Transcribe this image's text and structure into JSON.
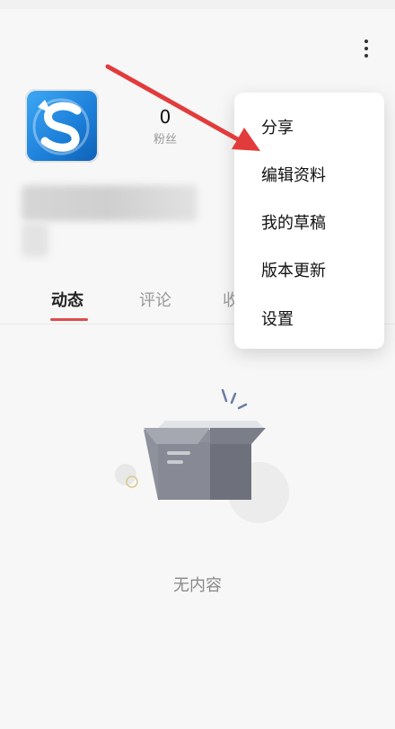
{
  "header": {
    "more_icon": "more-vertical-icon"
  },
  "profile": {
    "avatar_icon": "app-logo-s-icon",
    "fans_count": "0",
    "fans_label": "粉丝"
  },
  "tabs": {
    "items": [
      "动态",
      "评论",
      "收"
    ]
  },
  "empty": {
    "icon": "empty-box-icon",
    "text": "无内容"
  },
  "menu": {
    "items": [
      "分享",
      "编辑资料",
      "我的草稿",
      "版本更新",
      "设置"
    ]
  },
  "colors": {
    "accent": "#e04b4b",
    "annotation_arrow": "#e23b3b",
    "avatar_blue": "#1b7ed8"
  }
}
